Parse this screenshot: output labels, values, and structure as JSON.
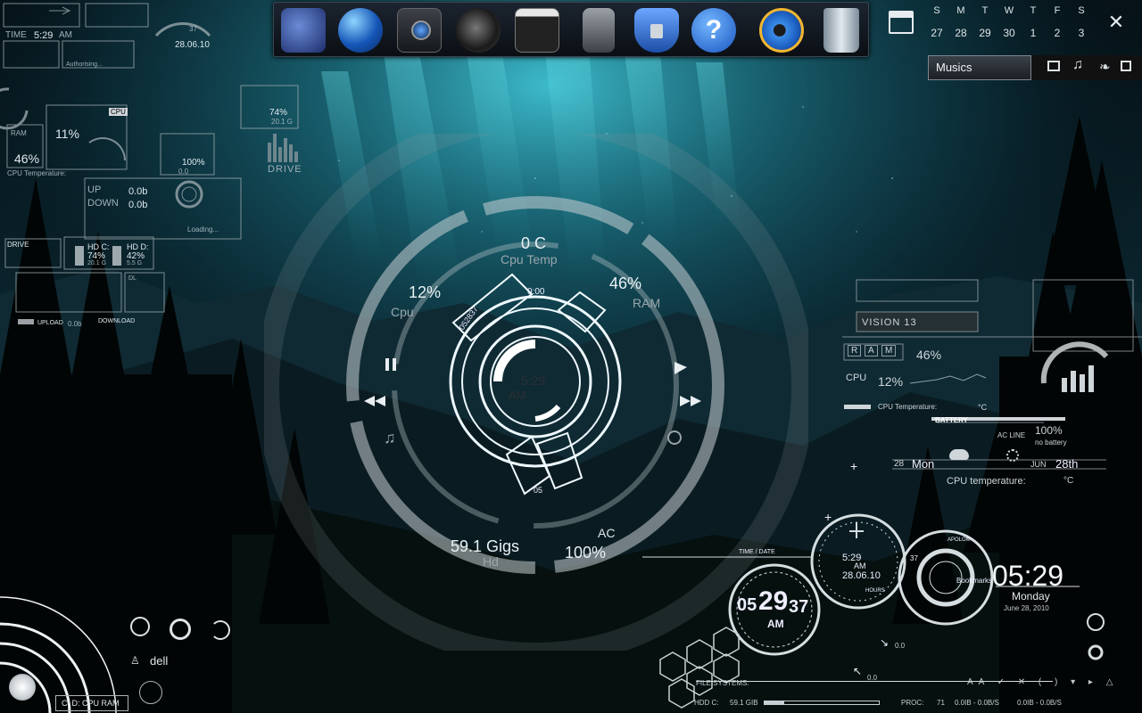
{
  "top_left": {
    "time_label": "TIME",
    "time_value": "5:29",
    "time_ampm": "AM",
    "date": "28.06.10",
    "day_num": "37",
    "auth": "Authorising...",
    "cpu_title": "CPU",
    "cpu_pct": "11%",
    "ram_label": "RAM",
    "ram_pct": "46%",
    "cpu_temp": "CPU Temperature:",
    "drive_a": "74%",
    "drive_a_size": "20.1 G",
    "drive_b": "100%",
    "drive_b_size": "0.0",
    "drive_word": "DRIVE",
    "up_label": "UP",
    "down_label": "DOWN",
    "up_val": "0.0b",
    "down_val": "0.0b",
    "loading": "Loading...",
    "hdc_label": "HD C:",
    "hdc_pct": "74%",
    "hdc_size": "20.1 G",
    "hdd_label": "HD D:",
    "hdd_pct": "42%",
    "hdd_size": "5.5 G",
    "drive2": "DRIVE",
    "upload": "UPLOAD",
    "upload_val": "0.0b",
    "download": "DOWNLOAD",
    "dl": "DL"
  },
  "dock": {
    "icons": [
      "games-icon",
      "internet-globe-icon",
      "camera-icon",
      "speaker-icon",
      "video-clapper-icon",
      "pencil-cup-icon",
      "security-shield-icon",
      "help-icon",
      "internet-explorer-icon",
      "recycle-bin-icon"
    ]
  },
  "calendar": {
    "days": [
      "S",
      "M",
      "T",
      "W",
      "T",
      "F",
      "S"
    ],
    "dates": [
      "27",
      "28",
      "29",
      "30",
      "1",
      "2",
      "3"
    ]
  },
  "musics": {
    "label": "Musics"
  },
  "center": {
    "temp": "0 C",
    "temp_label": "Cpu Temp",
    "cpu_pct": "12%",
    "cpu_label": "Cpu",
    "ram_pct": "46%",
    "ram_label": "RAM",
    "clock": "5:29",
    "clock_ampm": "AM",
    "inner_a": "0:00",
    "inner_b": "052837",
    "inner_c": "05",
    "hd_val": "59.1 Gigs",
    "hd_label": "Hd",
    "ac_label": "AC",
    "ac_pct": "100%"
  },
  "right": {
    "vision": "VISION 13",
    "ram_word": [
      "R",
      "A",
      "M"
    ],
    "ram_pct": "46%",
    "cpu_word": "CPU",
    "cpu_pct": "12%",
    "cpu_temp": "CPU Temperature:",
    "temp_unit": "°C",
    "battery": "BATTERY",
    "ac_line": "AC LINE",
    "battery_pct": "100%",
    "no_battery": "no battery",
    "day_num": "28",
    "day": "Mon",
    "month": "JUN",
    "day_ord": "28th",
    "cpu_temp2": "CPU temperature:",
    "temp_unit2": "°C"
  },
  "clocks": {
    "time_date": "TIME / DATE",
    "c1_time": "5:29",
    "c1_ampm": "AM",
    "c1_date": "28.06.10",
    "hours": "HOURS",
    "big_h": "05",
    "big_m": "29",
    "big_s": "37",
    "big_ampm": "AM",
    "apolo": "APOLOM",
    "sec": "37",
    "bookmarks": "Bookmarks",
    "digital": "05:29",
    "weekday": "Monday",
    "date_long": "June 28, 2010",
    "net_val": "0.0",
    "net_val2": "0.0",
    "file_systems": "FILE SYSTEMS:"
  },
  "bottom": {
    "hdd": "HDD C:",
    "hdd_val": "59.1 GIB",
    "proc": "PROC:",
    "proc_val": "71",
    "rate1": "0.0IB - 0.0B/S",
    "rate2": "0.0IB - 0.0B/S",
    "user": "dell",
    "quick": "C:  D:  CPU  RAM"
  }
}
